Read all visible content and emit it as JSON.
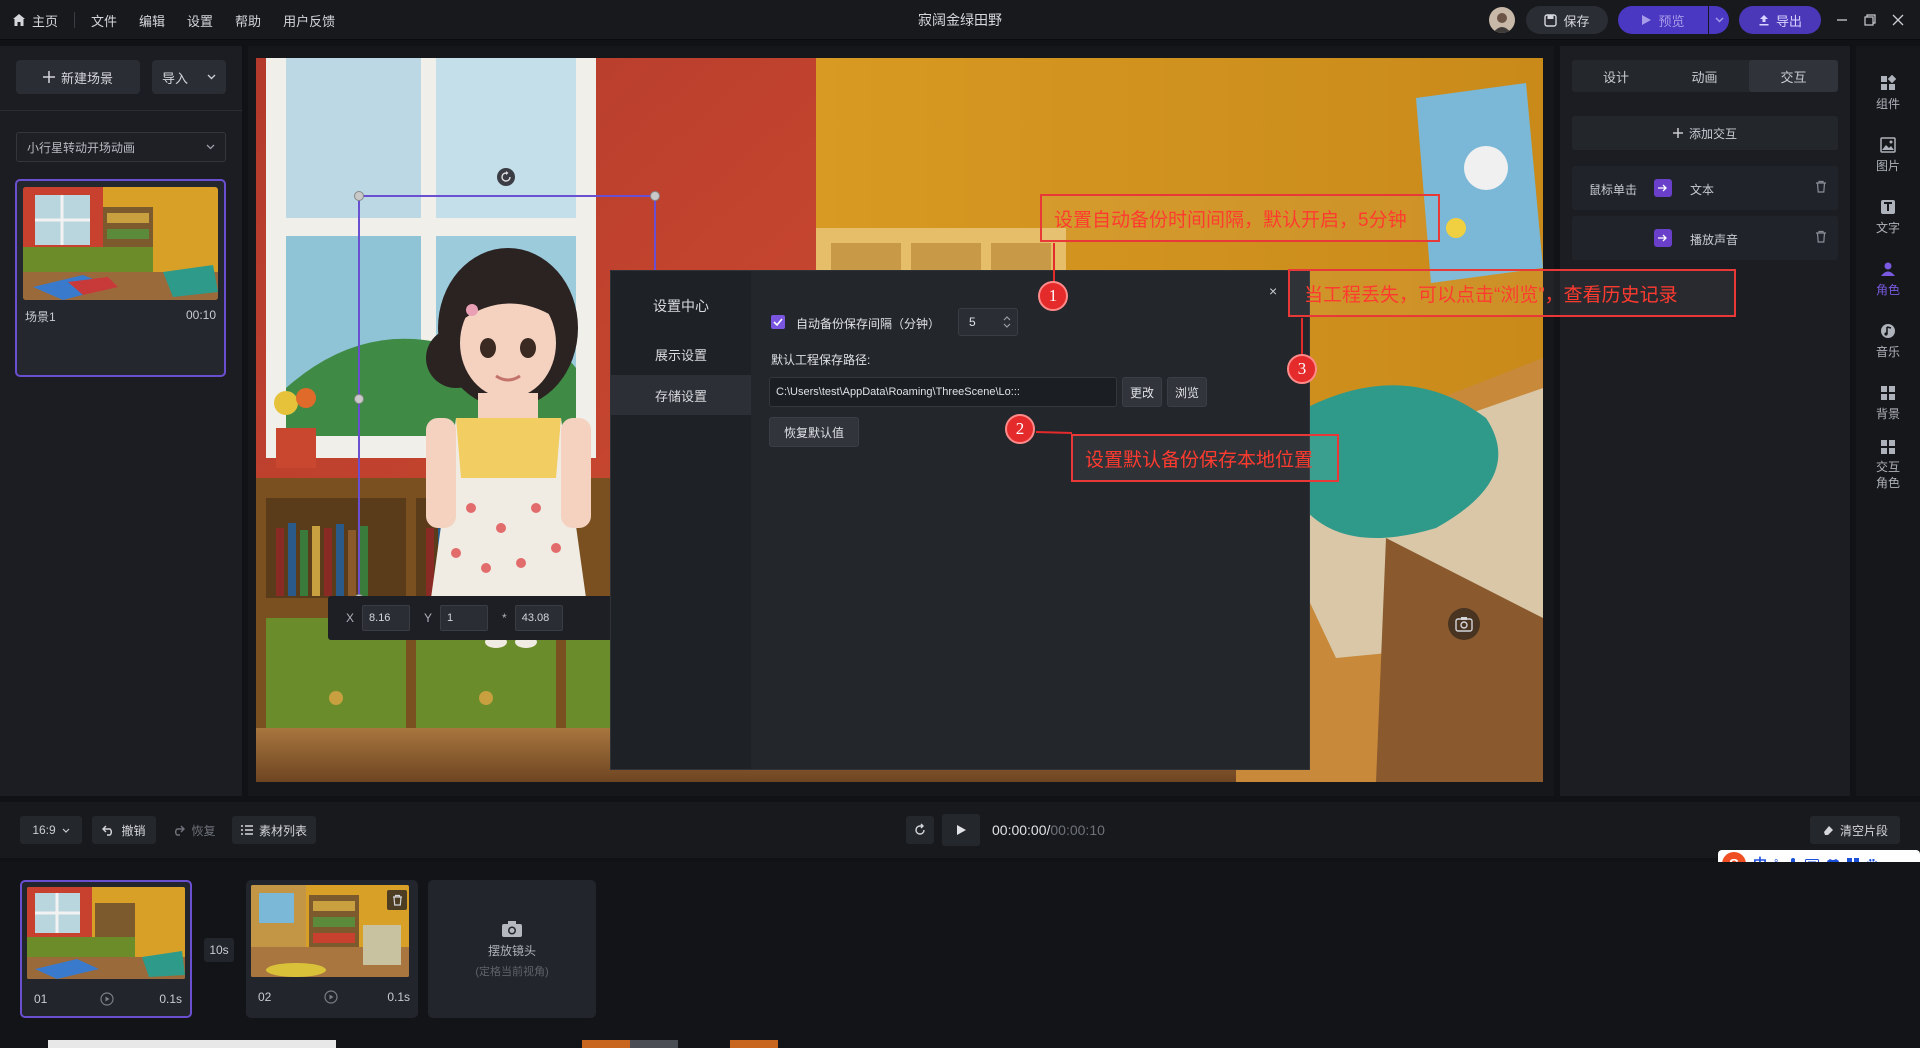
{
  "topbar": {
    "home": "主页",
    "menus": [
      "文件",
      "编辑",
      "设置",
      "帮助",
      "用户反馈"
    ],
    "title": "寂阔金绿田野",
    "save": "保存",
    "preview": "预览",
    "export": "导出"
  },
  "left_panel": {
    "new_scene": "新建场景",
    "import": "导入",
    "dropdown": "小行星转动开场动画",
    "scene_name": "场景1",
    "scene_time": "00:10"
  },
  "coords": {
    "x_label": "X",
    "x_value": "8.16",
    "y_label": "Y",
    "y_value": "1",
    "z_label": "*",
    "z_value": "43.08"
  },
  "right_panel": {
    "tabs": [
      "设计",
      "动画",
      "交互"
    ],
    "add_interaction": "添加交互",
    "trigger": "鼠标单击",
    "action1": "文本",
    "action2": "播放声音"
  },
  "right_toolbar": [
    {
      "icon": "grid-icon",
      "label": "组件"
    },
    {
      "icon": "image-icon",
      "label": "图片"
    },
    {
      "icon": "text-icon",
      "label": "文字"
    },
    {
      "icon": "character-icon",
      "label": "角色"
    },
    {
      "icon": "music-icon",
      "label": "音乐"
    },
    {
      "icon": "background-icon",
      "label": "背景"
    },
    {
      "icon": "interactive-character-icon",
      "label": "交互\n角色"
    }
  ],
  "dialog": {
    "title": "设置中心",
    "nav": [
      "展示设置",
      "存储设置"
    ],
    "autosave_label": "自动备份保存间隔（分钟）",
    "autosave_value": "5",
    "path_label": "默认工程保存路径:",
    "path_value": "C:\\Users\\test\\AppData\\Roaming\\ThreeScene\\Lo:::",
    "change": "更改",
    "browse": "浏览",
    "restore": "恢复默认值",
    "close": "×"
  },
  "annotations": [
    {
      "num": "1",
      "text": "设置自动备份时间间隔，默认开启，5分钟"
    },
    {
      "num": "2",
      "text": "设置默认备份保存本地位置"
    },
    {
      "num": "3",
      "text": "当工程丢失，可以点击“浏览”，查看历史记录"
    }
  ],
  "timeline_bar": {
    "ratio": "16:9",
    "undo": "撤销",
    "redo": "恢复",
    "assets": "素材列表",
    "time_current": "00:00:00",
    "time_sep": "/",
    "time_total": "00:00:10",
    "clear": "清空片段"
  },
  "clips": [
    {
      "name": "01",
      "duration": "0.1s"
    },
    {
      "name": "02",
      "duration": "0.1s"
    }
  ],
  "transition": "10s",
  "camera_slot": {
    "title": "摆放镜头",
    "hint": "(定格当前视角)"
  },
  "ime": [
    "中",
    "°,",
    "mic",
    "kbd",
    "shirt",
    "apps",
    "gear"
  ],
  "colors": {
    "accent_purple": "#5a3fd8",
    "annotation_red": "#e42a2a",
    "export_purple": "#4b38b8"
  }
}
